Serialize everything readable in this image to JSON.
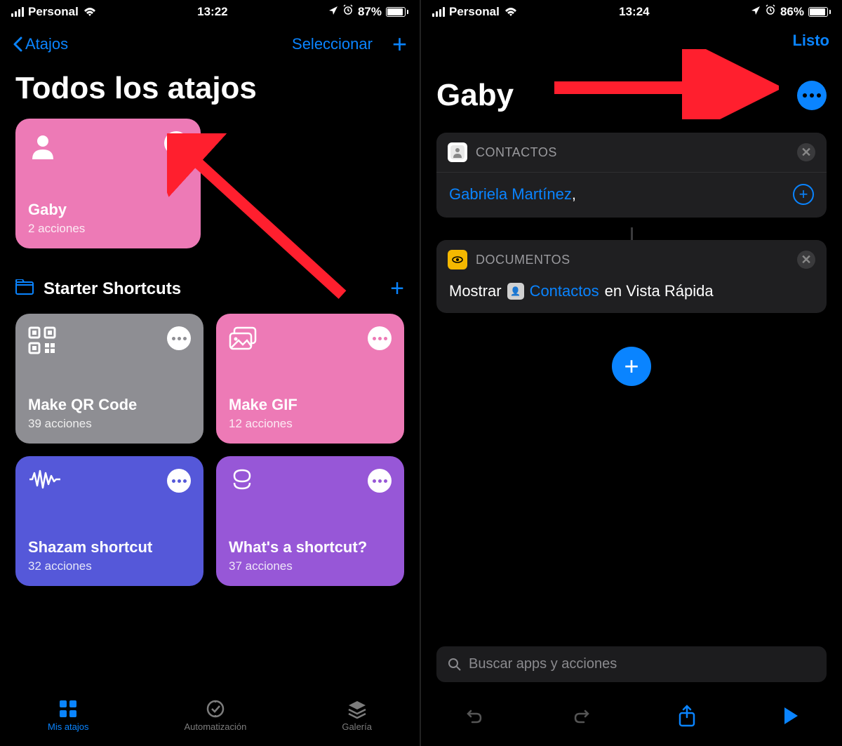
{
  "left": {
    "status": {
      "carrier": "Personal",
      "time": "13:22",
      "battery": "87%"
    },
    "nav": {
      "back": "Atajos",
      "select": "Seleccionar"
    },
    "title": "Todos los atajos",
    "main_card": {
      "name": "Gaby",
      "sub": "2 acciones",
      "color": "#ed7ab6",
      "dot_color": "#ed7ab6"
    },
    "folder": {
      "name": "Starter Shortcuts"
    },
    "cards": [
      {
        "name": "Make QR Code",
        "sub": "39 acciones",
        "color": "#8e8e93",
        "icon": "qr"
      },
      {
        "name": "Make GIF",
        "sub": "12 acciones",
        "color": "#ed7ab6",
        "icon": "photos"
      },
      {
        "name": "Shazam shortcut",
        "sub": "32 acciones",
        "color": "#5558d9",
        "icon": "wave"
      },
      {
        "name": "What's a shortcut?",
        "sub": "37 acciones",
        "color": "#9757d7",
        "icon": "layers"
      }
    ],
    "tabs": [
      {
        "label": "Mis atajos"
      },
      {
        "label": "Automatización"
      },
      {
        "label": "Galería"
      }
    ]
  },
  "right": {
    "status": {
      "carrier": "Personal",
      "time": "13:24",
      "battery": "86%"
    },
    "nav": {
      "done": "Listo"
    },
    "title": "Gaby",
    "actions": [
      {
        "app": "CONTACTOS",
        "body_link": "Gabriela Martínez",
        "suffix": ","
      },
      {
        "app": "DOCUMENTOS",
        "prefix": "Mostrar",
        "token": "Contactos",
        "suffix2": "en Vista Rápida"
      }
    ],
    "search_placeholder": "Buscar apps y acciones"
  }
}
